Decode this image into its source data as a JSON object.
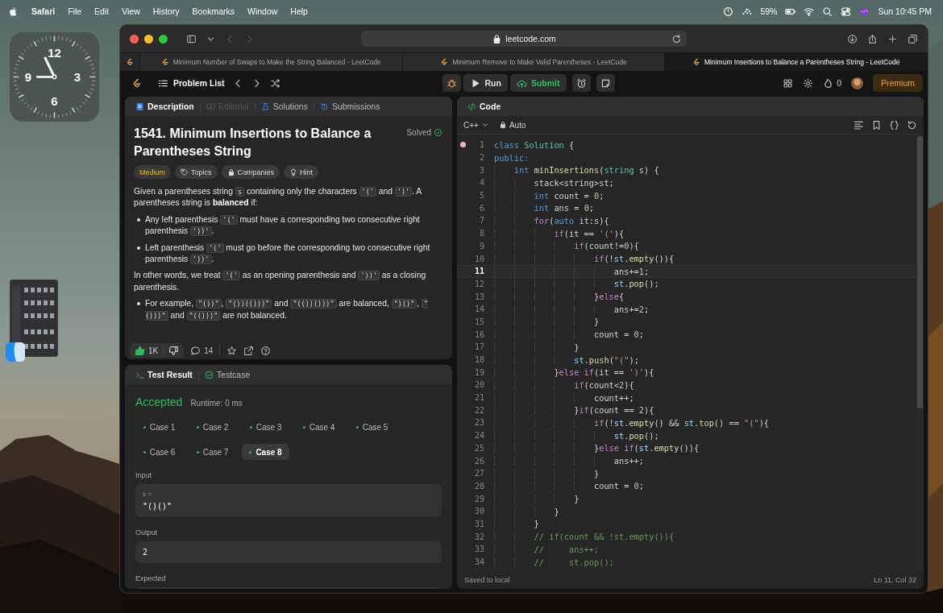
{
  "menu_bar": {
    "app": "Safari",
    "menus": [
      "File",
      "Edit",
      "View",
      "History",
      "Bookmarks",
      "Window",
      "Help"
    ],
    "battery": "59%",
    "clock": "Sun 10:45 PM"
  },
  "desktop": {
    "clock_widget": {
      "numerals": [
        "12",
        "3",
        "6",
        "9"
      ]
    }
  },
  "browser": {
    "address": "leetcode.com",
    "tabs": [
      {
        "title": "Minimum Number of Swaps to Make the String Balanced - LeetCode",
        "selected": false
      },
      {
        "title": "Minimum Remove to Make Valid Parentheses - LeetCode",
        "selected": false
      },
      {
        "title": "Minimum Insertions to Balance a Parentheses String - LeetCode",
        "selected": true
      }
    ]
  },
  "nav": {
    "problem_list": "Problem List",
    "run": "Run",
    "submit": "Submit",
    "streak": "0",
    "premium": "Premium"
  },
  "description": {
    "tabs": [
      {
        "label": "Description",
        "selected": true,
        "disabled": false
      },
      {
        "label": "Editorial",
        "selected": false,
        "disabled": true
      },
      {
        "label": "Solutions",
        "selected": false,
        "disabled": false
      },
      {
        "label": "Submissions",
        "selected": false,
        "disabled": false
      }
    ],
    "title": "1541. Minimum Insertions to Balance a Parentheses String",
    "status": "Solved",
    "tags": [
      {
        "label": "Medium",
        "kind": "difficulty"
      },
      {
        "label": "Topics",
        "kind": "chip"
      },
      {
        "label": "Companies",
        "kind": "chip"
      },
      {
        "label": "Hint",
        "kind": "chip"
      }
    ],
    "blocks": [
      {
        "kind": "para",
        "parts": [
          {
            "kind": "text",
            "text": "Given a parentheses string "
          },
          {
            "kind": "code",
            "text": "s"
          },
          {
            "kind": "text",
            "text": " containing only the characters "
          },
          {
            "kind": "code",
            "text": "'('"
          },
          {
            "kind": "text",
            "text": " and "
          },
          {
            "kind": "code",
            "text": "')'"
          },
          {
            "kind": "text",
            "text": ". A parentheses string is **balanced** if:"
          }
        ]
      },
      {
        "kind": "bullet",
        "parts": [
          {
            "kind": "text",
            "text": "Any left parenthesis "
          },
          {
            "kind": "code",
            "text": "'('"
          },
          {
            "kind": "text",
            "text": " must have a corresponding two consecutive right parenthesis "
          },
          {
            "kind": "code",
            "text": "'))'"
          },
          {
            "kind": "text",
            "text": "."
          }
        ]
      },
      {
        "kind": "bullet",
        "parts": [
          {
            "kind": "text",
            "text": "Left parenthesis "
          },
          {
            "kind": "code",
            "text": "'('"
          },
          {
            "kind": "text",
            "text": " must go before the corresponding two consecutive right parenthesis "
          },
          {
            "kind": "code",
            "text": "'))'"
          },
          {
            "kind": "text",
            "text": "."
          }
        ]
      },
      {
        "kind": "para",
        "parts": [
          {
            "kind": "text",
            "text": "In other words, we treat "
          },
          {
            "kind": "code",
            "text": "'('"
          },
          {
            "kind": "text",
            "text": " as an opening parenthesis and "
          },
          {
            "kind": "code",
            "text": "'))'"
          },
          {
            "kind": "text",
            "text": " as a closing parenthesis."
          }
        ]
      },
      {
        "kind": "bullet",
        "parts": [
          {
            "kind": "text",
            "text": "For example, "
          },
          {
            "kind": "code",
            "text": "\"())\""
          },
          {
            "kind": "text",
            "text": ", "
          },
          {
            "kind": "code",
            "text": "\"())(()))\""
          },
          {
            "kind": "text",
            "text": " and "
          },
          {
            "kind": "code",
            "text": "\"(())()))\""
          },
          {
            "kind": "text",
            "text": " are balanced, "
          },
          {
            "kind": "code",
            "text": "\")()\""
          },
          {
            "kind": "text",
            "text": ", "
          },
          {
            "kind": "code",
            "text": "\"()))\""
          },
          {
            "kind": "text",
            "text": " and "
          },
          {
            "kind": "code",
            "text": "\"(()))\""
          },
          {
            "kind": "text",
            "text": " are not balanced."
          }
        ]
      }
    ],
    "likes": "1K",
    "comments": "14"
  },
  "test_result": {
    "tabs": [
      {
        "label": "Test Result",
        "selected": true
      },
      {
        "label": "Testcase",
        "selected": false
      }
    ],
    "verdict": "Accepted",
    "runtime": "Runtime: 0 ms",
    "cases": [
      {
        "label": "Case 1",
        "selected": false,
        "passed": true
      },
      {
        "label": "Case 2",
        "selected": false,
        "passed": true
      },
      {
        "label": "Case 3",
        "selected": false,
        "passed": true
      },
      {
        "label": "Case 4",
        "selected": false,
        "passed": true
      },
      {
        "label": "Case 5",
        "selected": false,
        "passed": true
      },
      {
        "label": "Case 6",
        "selected": false,
        "passed": true
      },
      {
        "label": "Case 7",
        "selected": false,
        "passed": true
      },
      {
        "label": "Case 8",
        "selected": true,
        "passed": true
      }
    ],
    "input_label": "Input",
    "inputs": [
      {
        "name": "s =",
        "value": "\"()()\""
      }
    ],
    "output_label": "Output",
    "output": "2",
    "expected_label": "Expected"
  },
  "editor": {
    "title": "Code",
    "language": "C++",
    "mode": "Auto",
    "status": "Saved to local",
    "cursor": "Ln 11, Col 32",
    "lines": [
      {
        "number": "1",
        "breakpoint": true,
        "current": false,
        "tokens": [
          {
            "kind": "kw",
            "text": "class "
          },
          {
            "kind": "ty",
            "text": "Solution"
          },
          {
            "kind": "p",
            "text": " {"
          }
        ]
      },
      {
        "number": "2",
        "breakpoint": false,
        "current": false,
        "tokens": [
          {
            "kind": "kw",
            "text": "public:"
          }
        ]
      },
      {
        "number": "3",
        "breakpoint": false,
        "current": false,
        "tokens": [
          {
            "kind": "kw",
            "text": "    int "
          },
          {
            "kind": "fn",
            "text": "minInsertions"
          },
          {
            "kind": "p",
            "text": "("
          },
          {
            "kind": "ty",
            "text": "string"
          },
          {
            "kind": "p",
            "text": " s) {"
          }
        ]
      },
      {
        "number": "4",
        "breakpoint": false,
        "current": false,
        "tokens": [
          {
            "kind": "p",
            "text": "        stack<string>st;"
          }
        ]
      },
      {
        "number": "5",
        "breakpoint": false,
        "current": false,
        "tokens": [
          {
            "kind": "kw",
            "text": "        int"
          },
          {
            "kind": "p",
            "text": " count = "
          },
          {
            "kind": "num",
            "text": "0"
          },
          {
            "kind": "p",
            "text": ";"
          }
        ]
      },
      {
        "number": "6",
        "breakpoint": false,
        "current": false,
        "tokens": [
          {
            "kind": "kw",
            "text": "        int"
          },
          {
            "kind": "p",
            "text": " ans = "
          },
          {
            "kind": "num",
            "text": "0"
          },
          {
            "kind": "p",
            "text": ";"
          }
        ]
      },
      {
        "number": "7",
        "breakpoint": false,
        "current": false,
        "tokens": [
          {
            "kind": "ctl",
            "text": "        for"
          },
          {
            "kind": "p",
            "text": "("
          },
          {
            "kind": "kw",
            "text": "auto"
          },
          {
            "kind": "p",
            "text": " it:s){"
          }
        ]
      },
      {
        "number": "8",
        "breakpoint": false,
        "current": false,
        "tokens": [
          {
            "kind": "ctl",
            "text": "            if"
          },
          {
            "kind": "p",
            "text": "(it == "
          },
          {
            "kind": "str",
            "text": "'('"
          },
          {
            "kind": "p",
            "text": "){"
          }
        ]
      },
      {
        "number": "9",
        "breakpoint": false,
        "current": false,
        "tokens": [
          {
            "kind": "ctl",
            "text": "                if"
          },
          {
            "kind": "p",
            "text": "(count!="
          },
          {
            "kind": "num",
            "text": "0"
          },
          {
            "kind": "p",
            "text": "){"
          }
        ]
      },
      {
        "number": "10",
        "breakpoint": false,
        "current": false,
        "tokens": [
          {
            "kind": "ctl",
            "text": "                    if"
          },
          {
            "kind": "p",
            "text": "(!"
          },
          {
            "kind": "var",
            "text": "st"
          },
          {
            "kind": "p",
            "text": "."
          },
          {
            "kind": "fn",
            "text": "empty"
          },
          {
            "kind": "p",
            "text": "()){"
          }
        ]
      },
      {
        "number": "11",
        "breakpoint": false,
        "current": true,
        "tokens": [
          {
            "kind": "p",
            "text": "                        ans+="
          },
          {
            "kind": "num",
            "text": "1"
          },
          {
            "kind": "p",
            "text": ";"
          }
        ]
      },
      {
        "number": "12",
        "breakpoint": false,
        "current": false,
        "tokens": [
          {
            "kind": "var",
            "text": "                        st"
          },
          {
            "kind": "p",
            "text": "."
          },
          {
            "kind": "fn",
            "text": "pop"
          },
          {
            "kind": "p",
            "text": "();"
          }
        ]
      },
      {
        "number": "13",
        "breakpoint": false,
        "current": false,
        "tokens": [
          {
            "kind": "p",
            "text": "                    }"
          },
          {
            "kind": "ctl",
            "text": "else"
          },
          {
            "kind": "p",
            "text": "{"
          }
        ]
      },
      {
        "number": "14",
        "breakpoint": false,
        "current": false,
        "tokens": [
          {
            "kind": "p",
            "text": "                        ans+="
          },
          {
            "kind": "num",
            "text": "2"
          },
          {
            "kind": "p",
            "text": ";"
          }
        ]
      },
      {
        "number": "15",
        "breakpoint": false,
        "current": false,
        "tokens": [
          {
            "kind": "p",
            "text": "                    }"
          }
        ]
      },
      {
        "number": "16",
        "breakpoint": false,
        "current": false,
        "tokens": [
          {
            "kind": "p",
            "text": "                    count = "
          },
          {
            "kind": "num",
            "text": "0"
          },
          {
            "kind": "p",
            "text": ";"
          }
        ]
      },
      {
        "number": "17",
        "breakpoint": false,
        "current": false,
        "tokens": [
          {
            "kind": "p",
            "text": "                }"
          }
        ]
      },
      {
        "number": "18",
        "breakpoint": false,
        "current": false,
        "tokens": [
          {
            "kind": "var",
            "text": "                st"
          },
          {
            "kind": "p",
            "text": "."
          },
          {
            "kind": "fn",
            "text": "push"
          },
          {
            "kind": "p",
            "text": "("
          },
          {
            "kind": "str",
            "text": "\"(\""
          },
          {
            "kind": "p",
            "text": ");"
          }
        ]
      },
      {
        "number": "19",
        "breakpoint": false,
        "current": false,
        "tokens": [
          {
            "kind": "p",
            "text": "            }"
          },
          {
            "kind": "ctl",
            "text": "else if"
          },
          {
            "kind": "p",
            "text": "(it == "
          },
          {
            "kind": "str",
            "text": "')'"
          },
          {
            "kind": "p",
            "text": "){"
          }
        ]
      },
      {
        "number": "20",
        "breakpoint": false,
        "current": false,
        "tokens": [
          {
            "kind": "ctl",
            "text": "                if"
          },
          {
            "kind": "p",
            "text": "(count<"
          },
          {
            "kind": "num",
            "text": "2"
          },
          {
            "kind": "p",
            "text": "){"
          }
        ]
      },
      {
        "number": "21",
        "breakpoint": false,
        "current": false,
        "tokens": [
          {
            "kind": "p",
            "text": "                    count++;"
          }
        ]
      },
      {
        "number": "22",
        "breakpoint": false,
        "current": false,
        "tokens": [
          {
            "kind": "p",
            "text": "                }"
          },
          {
            "kind": "ctl",
            "text": "if"
          },
          {
            "kind": "p",
            "text": "(count == "
          },
          {
            "kind": "num",
            "text": "2"
          },
          {
            "kind": "p",
            "text": "){"
          }
        ]
      },
      {
        "number": "23",
        "breakpoint": false,
        "current": false,
        "tokens": [
          {
            "kind": "ctl",
            "text": "                    if"
          },
          {
            "kind": "p",
            "text": "(!"
          },
          {
            "kind": "var",
            "text": "st"
          },
          {
            "kind": "p",
            "text": "."
          },
          {
            "kind": "fn",
            "text": "empty"
          },
          {
            "kind": "p",
            "text": "() && "
          },
          {
            "kind": "var",
            "text": "st"
          },
          {
            "kind": "p",
            "text": "."
          },
          {
            "kind": "fn",
            "text": "top"
          },
          {
            "kind": "p",
            "text": "() == "
          },
          {
            "kind": "str",
            "text": "\"(\""
          },
          {
            "kind": "p",
            "text": "){"
          }
        ]
      },
      {
        "number": "24",
        "breakpoint": false,
        "current": false,
        "tokens": [
          {
            "kind": "var",
            "text": "                        st"
          },
          {
            "kind": "p",
            "text": "."
          },
          {
            "kind": "fn",
            "text": "pop"
          },
          {
            "kind": "p",
            "text": "();"
          }
        ]
      },
      {
        "number": "25",
        "breakpoint": false,
        "current": false,
        "tokens": [
          {
            "kind": "p",
            "text": "                    }"
          },
          {
            "kind": "ctl",
            "text": "else if"
          },
          {
            "kind": "p",
            "text": "("
          },
          {
            "kind": "var",
            "text": "st"
          },
          {
            "kind": "p",
            "text": "."
          },
          {
            "kind": "fn",
            "text": "empty"
          },
          {
            "kind": "p",
            "text": "()){"
          }
        ]
      },
      {
        "number": "26",
        "breakpoint": false,
        "current": false,
        "tokens": [
          {
            "kind": "p",
            "text": "                        ans++;"
          }
        ]
      },
      {
        "number": "27",
        "breakpoint": false,
        "current": false,
        "tokens": [
          {
            "kind": "p",
            "text": "                    }"
          }
        ]
      },
      {
        "number": "28",
        "breakpoint": false,
        "current": false,
        "tokens": [
          {
            "kind": "p",
            "text": "                    count = "
          },
          {
            "kind": "num",
            "text": "0"
          },
          {
            "kind": "p",
            "text": ";"
          }
        ]
      },
      {
        "number": "29",
        "breakpoint": false,
        "current": false,
        "tokens": [
          {
            "kind": "p",
            "text": "                }"
          }
        ]
      },
      {
        "number": "30",
        "breakpoint": false,
        "current": false,
        "tokens": [
          {
            "kind": "p",
            "text": "            }"
          }
        ]
      },
      {
        "number": "31",
        "breakpoint": false,
        "current": false,
        "tokens": [
          {
            "kind": "p",
            "text": "        }"
          }
        ]
      },
      {
        "number": "32",
        "breakpoint": false,
        "current": false,
        "tokens": [
          {
            "kind": "com",
            "text": "        // if(count && !st.empty()){"
          }
        ]
      },
      {
        "number": "33",
        "breakpoint": false,
        "current": false,
        "tokens": [
          {
            "kind": "com",
            "text": "        //     ans++;"
          }
        ]
      },
      {
        "number": "34",
        "breakpoint": false,
        "current": false,
        "tokens": [
          {
            "kind": "com",
            "text": "        //     st.pop();"
          }
        ]
      }
    ]
  }
}
